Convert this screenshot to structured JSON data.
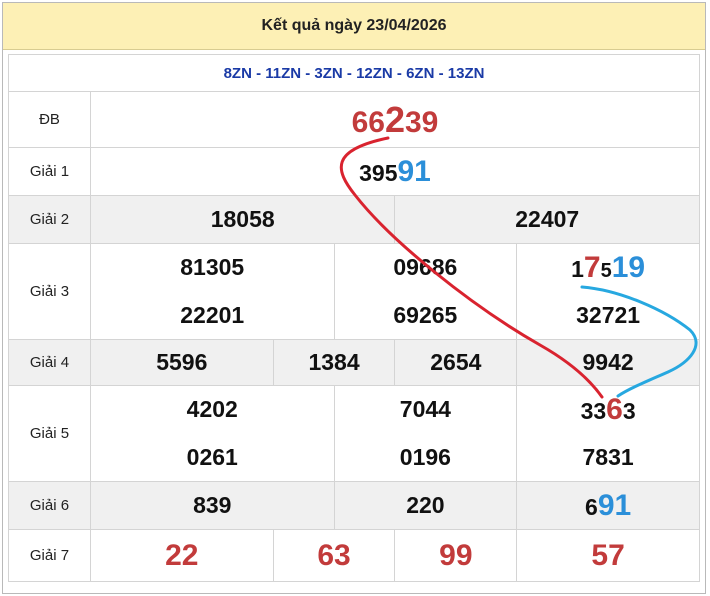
{
  "header": {
    "title": "Kết quả ngày 23/04/2026"
  },
  "codes": "8ZN - 11ZN - 3ZN - 12ZN - 6ZN - 13ZN",
  "labels": {
    "db": "ĐB",
    "g1": "Giải 1",
    "g2": "Giải 2",
    "g3": "Giải 3",
    "g4": "Giải 4",
    "g5": "Giải 5",
    "g6": "Giải 6",
    "g7": "Giải 7"
  },
  "special": {
    "a": "66",
    "b": "2",
    "c": "39"
  },
  "g1": {
    "a": "395",
    "b": "91"
  },
  "g2": [
    "18058",
    "22407"
  ],
  "g3": {
    "r1": [
      "81305",
      "09686"
    ],
    "r1c3": {
      "a": "1",
      "b": "7",
      "c": "5",
      "d": "19"
    },
    "r2": [
      "22201",
      "69265",
      "32721"
    ]
  },
  "g4": [
    "5596",
    "1384",
    "2654",
    "9942"
  ],
  "g5": {
    "r1": [
      "4202",
      "7044"
    ],
    "r1c3": {
      "a": "33",
      "b": "6",
      "c": "3"
    },
    "r2": [
      "0261",
      "0196",
      "7831"
    ]
  },
  "g6": {
    "v1": "839",
    "v2": "220",
    "v3a": "6",
    "v3b": "91"
  },
  "g7": [
    "22",
    "63",
    "99",
    "57"
  ],
  "colors": {
    "red_line": "#d9232f",
    "blue_line": "#27a8e0",
    "header_bg": "#fdf0b5"
  }
}
